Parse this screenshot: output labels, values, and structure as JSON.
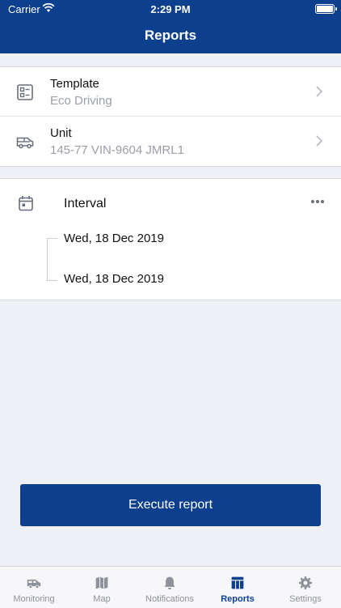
{
  "status_bar": {
    "carrier": "Carrier",
    "time": "2:29 PM"
  },
  "header": {
    "title": "Reports"
  },
  "template_row": {
    "label": "Template",
    "value": "Eco Driving"
  },
  "unit_row": {
    "label": "Unit",
    "value": "145-77 VIN-9604  JMRL1"
  },
  "interval": {
    "label": "Interval",
    "date_from": "Wed, 18 Dec 2019",
    "date_to": "Wed, 18 Dec 2019"
  },
  "execute_button": {
    "label": "Execute report"
  },
  "tabs": [
    {
      "label": "Monitoring",
      "icon": "van-icon"
    },
    {
      "label": "Map",
      "icon": "map-icon"
    },
    {
      "label": "Notifications",
      "icon": "bell-icon"
    },
    {
      "label": "Reports",
      "icon": "reports-icon",
      "active": true
    },
    {
      "label": "Settings",
      "icon": "gear-icon"
    }
  ],
  "colors": {
    "primary": "#0d3f8f",
    "background": "#eef0f6",
    "muted": "#9a9ea6"
  }
}
